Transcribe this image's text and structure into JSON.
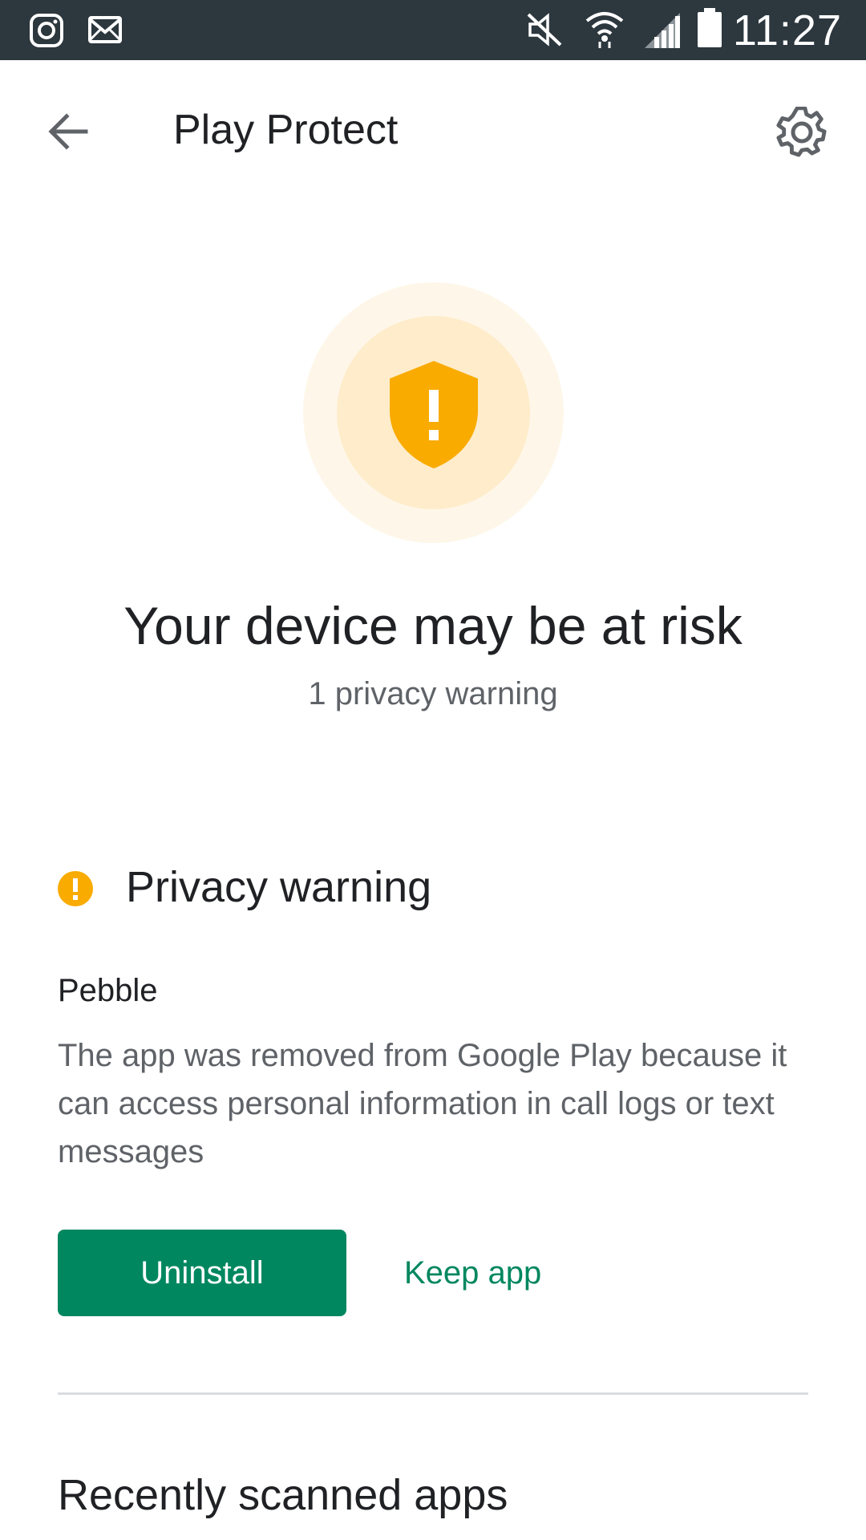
{
  "status_bar": {
    "time": "11:27",
    "left_icons": [
      "instagram-icon",
      "mail-icon"
    ],
    "right_icons": [
      "mute-icon",
      "wifi-icon",
      "signal-icon",
      "battery-icon"
    ]
  },
  "app_bar": {
    "title": "Play Protect",
    "back_icon": "arrow-back-icon",
    "settings_icon": "gear-icon"
  },
  "status": {
    "headline": "Your device may be at risk",
    "subtitle": "1 privacy warning",
    "icon": "shield-warning-icon",
    "colors": {
      "warning": "#f9ab00",
      "halo_outer": "#fef7e9",
      "halo_inner": "#feeccb"
    }
  },
  "privacy_warning": {
    "title": "Privacy warning",
    "icon": "warning-circle-icon",
    "app_name": "Pebble",
    "description": "The app was removed from Google Play because it can access personal information in call logs or text messages",
    "uninstall_label": "Uninstall",
    "keep_label": "Keep app",
    "accent": "#01875f"
  },
  "recent": {
    "title": "Recently scanned apps"
  }
}
